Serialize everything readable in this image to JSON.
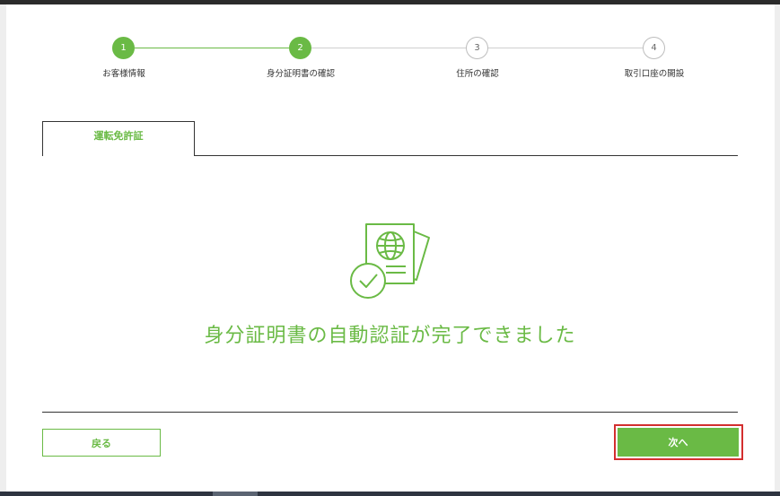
{
  "stepper": {
    "steps": [
      {
        "number": "1",
        "label": "お客様情報",
        "state": "done"
      },
      {
        "number": "2",
        "label": "身分証明書の確認",
        "state": "current"
      },
      {
        "number": "3",
        "label": "住所の確認",
        "state": "pending"
      },
      {
        "number": "4",
        "label": "取引口座の開設",
        "state": "pending"
      }
    ]
  },
  "tabs": [
    {
      "label": "運転免許証",
      "active": true
    }
  ],
  "main": {
    "icon": "passport-check-icon",
    "message": "身分証明書の自動認証が完了できました"
  },
  "footer": {
    "back_label": "戻る",
    "next_label": "次へ"
  },
  "colors": {
    "accent": "#6aba45",
    "highlight": "#d32f2f",
    "pending_border": "#bdbdbd"
  }
}
